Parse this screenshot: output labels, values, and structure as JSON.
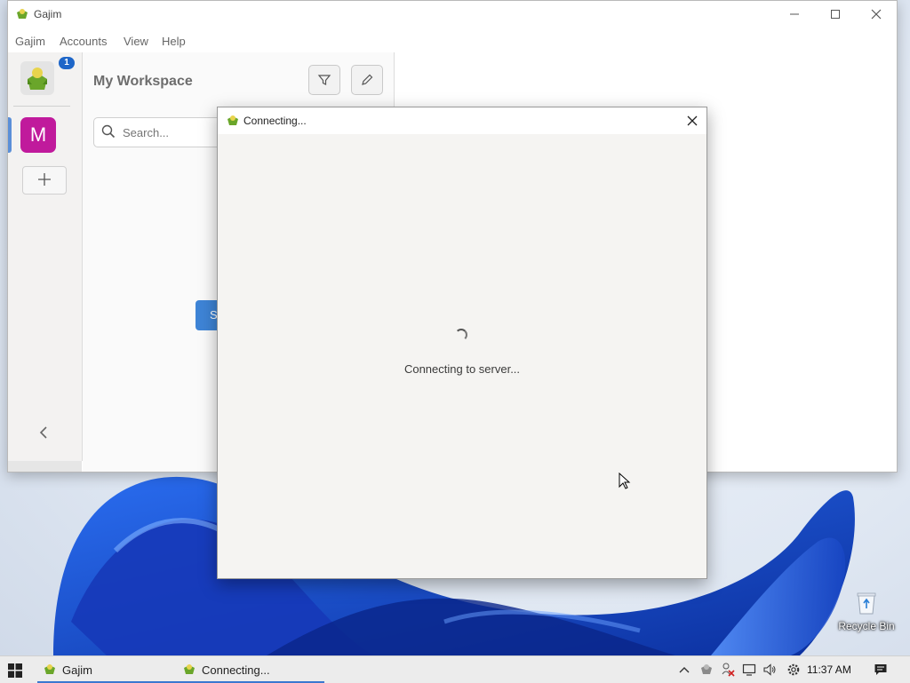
{
  "main_window": {
    "title": "Gajim",
    "menu": [
      "Gajim",
      "Accounts",
      "View",
      "Help"
    ],
    "account_badge": "1",
    "workspace_initial": "M",
    "workspace_title": "My Workspace",
    "search_placeholder": "Search...",
    "blue_button_label": "S"
  },
  "dialog": {
    "title": "Connecting...",
    "status": "Connecting to server..."
  },
  "desktop": {
    "recycle_bin_label": "Recycle Bin"
  },
  "taskbar": {
    "tasks": [
      "Gajim",
      "Connecting..."
    ],
    "time": "11:37 AM"
  },
  "colors": {
    "accent": "#3e84d6",
    "workspace_avatar": "#c01a9c",
    "badge": "#1e66c8",
    "wallpaper_blue": "#1a4fd6"
  }
}
